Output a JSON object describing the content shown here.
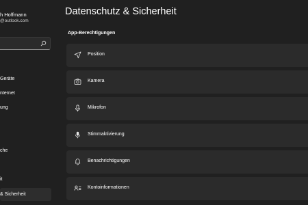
{
  "sidebar": {
    "user_name": "h Hoffmann",
    "user_email": "@outlook.com",
    "items": [
      {
        "label": "Geräte"
      },
      {
        "label": "nternet"
      },
      {
        "label": "ung"
      },
      {
        "label": "che"
      },
      {
        "label": "it"
      },
      {
        "label": "& Sicherheit"
      }
    ]
  },
  "main": {
    "title": "Datenschutz & Sicherheit",
    "section_title": "App-Berechtigungen",
    "cards": [
      {
        "label": "Position",
        "icon": "location-icon"
      },
      {
        "label": "Kamera",
        "icon": "camera-icon"
      },
      {
        "label": "Mikrofon",
        "icon": "microphone-icon"
      },
      {
        "label": "Stimmaktivierung",
        "icon": "voice-activation-icon"
      },
      {
        "label": "Benachrichtigungen",
        "icon": "bell-icon"
      },
      {
        "label": "Kontoinformationen",
        "icon": "account-info-icon"
      }
    ]
  },
  "colors": {
    "background": "#202020",
    "card": "#2b2b2b",
    "selected": "#2d2d2d"
  }
}
